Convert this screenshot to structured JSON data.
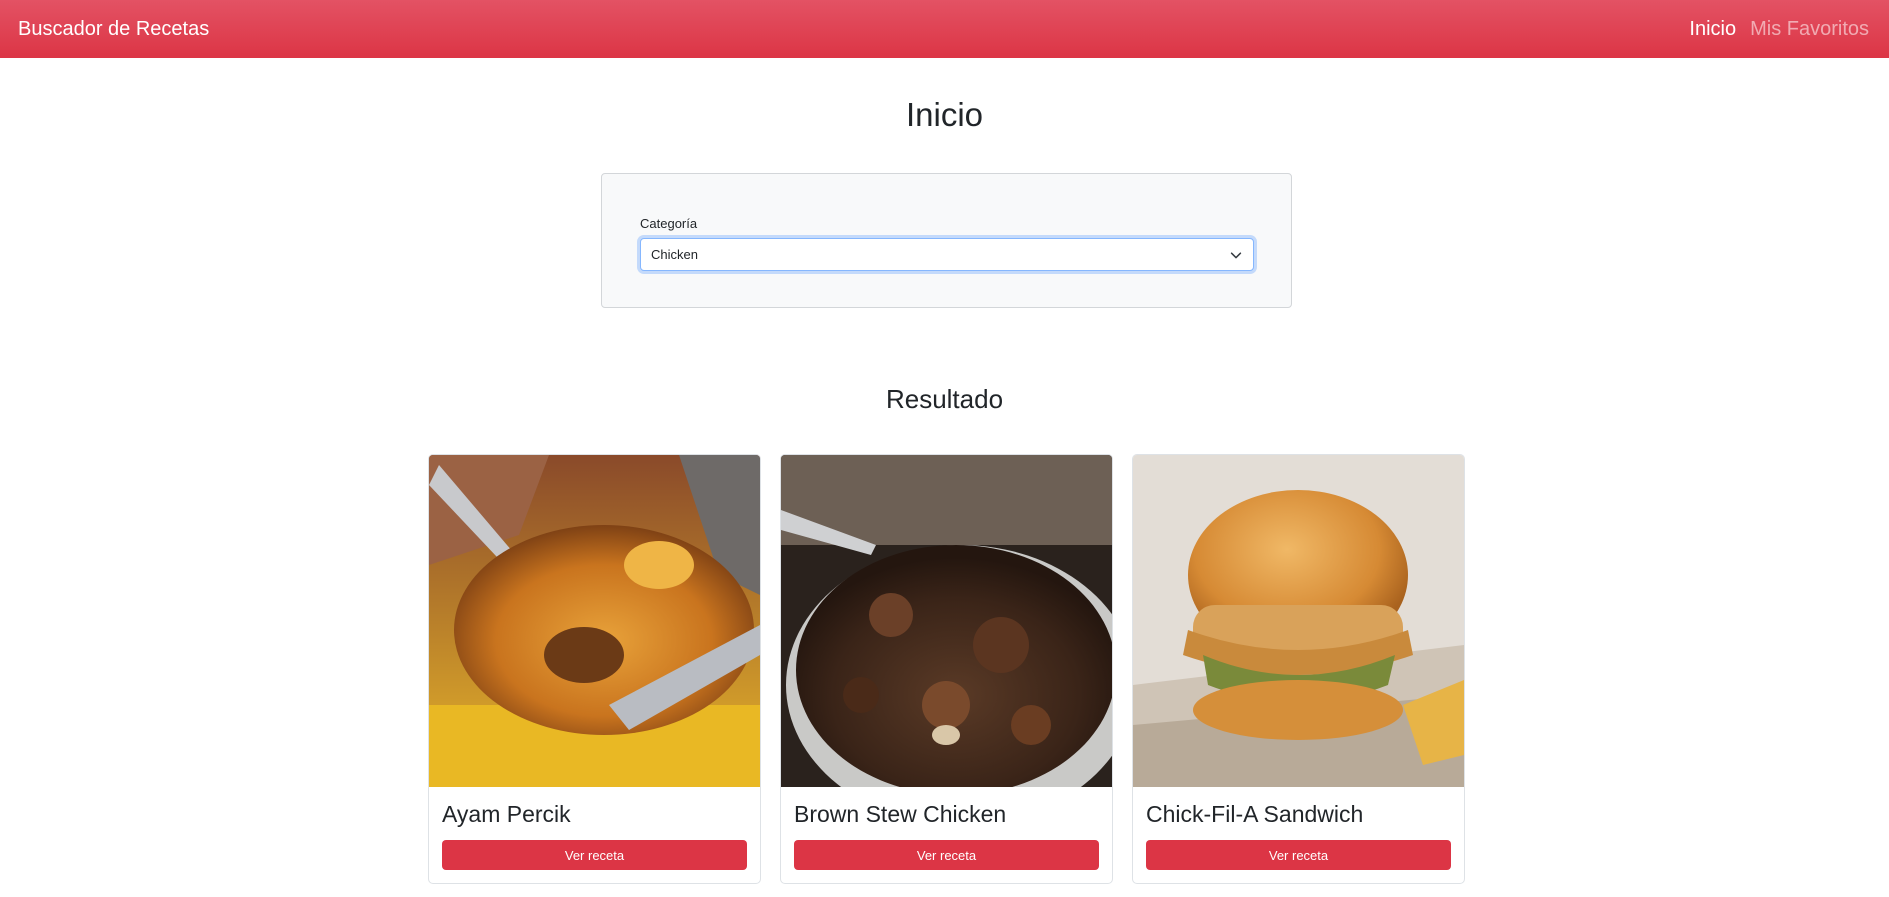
{
  "navbar": {
    "brand": "Buscador de Recetas",
    "links": [
      {
        "label": "Inicio",
        "active": true
      },
      {
        "label": "Mis Favoritos",
        "active": false
      }
    ],
    "color": "#dc3545"
  },
  "page": {
    "title": "Inicio"
  },
  "filter": {
    "category_label": "Categoría",
    "category_value": "Chicken",
    "chevron_icon": "chevron-down-icon"
  },
  "results": {
    "title": "Resultado",
    "cards": [
      {
        "title": "Ayam Percik",
        "button_label": "Ver receta",
        "image": "baked-chicken-photo"
      },
      {
        "title": "Brown Stew Chicken",
        "button_label": "Ver receta",
        "image": "stew-chicken-photo"
      },
      {
        "title": "Chick-Fil-A Sandwich",
        "button_label": "Ver receta",
        "image": "chicken-sandwich-photo"
      }
    ]
  },
  "colors": {
    "accent": "#dc3545",
    "panel_bg": "#f8f9fa",
    "focus_border": "#86b7fe"
  }
}
